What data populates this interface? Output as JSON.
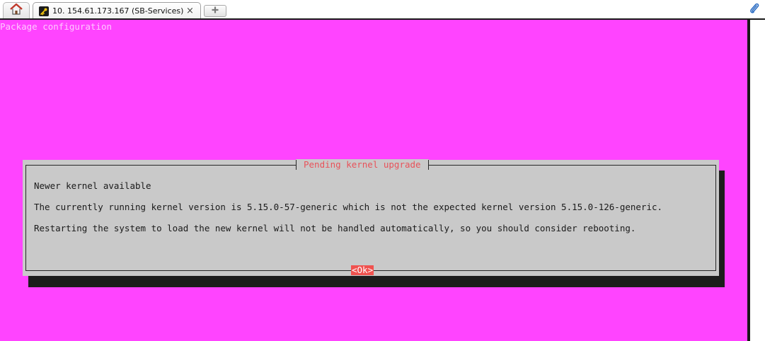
{
  "browser": {
    "home_icon": "home-icon",
    "tab": {
      "title": "10. 154.61.173.167 (SB-Services)",
      "icon": "key-icon",
      "close_label": "×"
    },
    "new_tab_icon": "new-tab-plus-icon",
    "attach_icon": "paperclip-icon"
  },
  "terminal": {
    "backtitle": "Package configuration",
    "dialog": {
      "title": "Pending kernel upgrade",
      "lines": [
        "Newer kernel available",
        "The currently running kernel version is 5.15.0-57-generic which is not the expected kernel version 5.15.0-126-generic.",
        "Restarting the system to load the new kernel will not be handled automatically, so you should consider rebooting."
      ],
      "ok_label": "<Ok>"
    }
  },
  "colors": {
    "terminal_bg": "#ff44ff",
    "dialog_bg": "#c9c9c9",
    "dialog_shadow": "#1d1d1d",
    "title_red": "#e8535a",
    "button_bg": "#f0524f"
  }
}
